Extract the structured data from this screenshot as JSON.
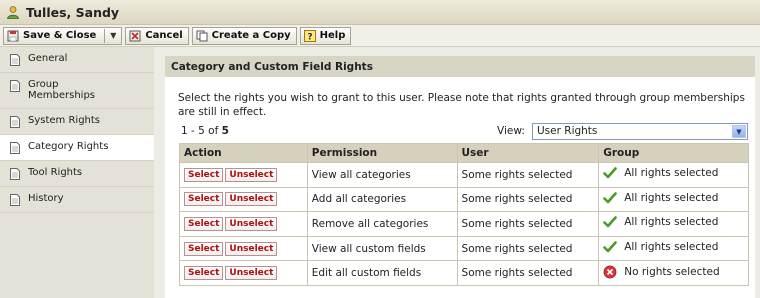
{
  "window": {
    "title": "Tulles, Sandy"
  },
  "toolbar": {
    "save_close": "Save & Close",
    "cancel": "Cancel",
    "copy": "Create a Copy",
    "help": "Help"
  },
  "sidebar": {
    "items": [
      {
        "label": "General"
      },
      {
        "label": "Group Memberships"
      },
      {
        "label": "System Rights"
      },
      {
        "label": "Category Rights"
      },
      {
        "label": "Tool Rights"
      },
      {
        "label": "History"
      }
    ]
  },
  "section": {
    "title": "Category and Custom Field Rights",
    "instructions": "Select the rights you wish to grant to this user. Please note that rights granted through group memberships are still in effect.",
    "count_prefix": "1 - 5 of ",
    "count_total": "5",
    "view_label": "View:",
    "view_selected": "User Rights"
  },
  "table": {
    "headers": {
      "action": "Action",
      "permission": "Permission",
      "user": "User",
      "group": "Group"
    },
    "select_label": "Select",
    "unselect_label": "Unselect",
    "rows": [
      {
        "permission": "View all categories",
        "user": "Some rights selected",
        "group": "All rights selected",
        "group_icon": "check-icon"
      },
      {
        "permission": "Add all categories",
        "user": "Some rights selected",
        "group": "All rights selected",
        "group_icon": "check-icon"
      },
      {
        "permission": "Remove all categories",
        "user": "Some rights selected",
        "group": "All rights selected",
        "group_icon": "check-icon"
      },
      {
        "permission": "View all custom fields",
        "user": "Some rights selected",
        "group": "All rights selected",
        "group_icon": "check-icon"
      },
      {
        "permission": "Edit all custom fields",
        "user": "Some rights selected",
        "group": "No rights selected",
        "group_icon": "x-circle-icon"
      }
    ]
  },
  "colors": {
    "accent_red": "#b01010",
    "check_green": "#4a9a2a",
    "header_bg": "#d6d1bd"
  }
}
